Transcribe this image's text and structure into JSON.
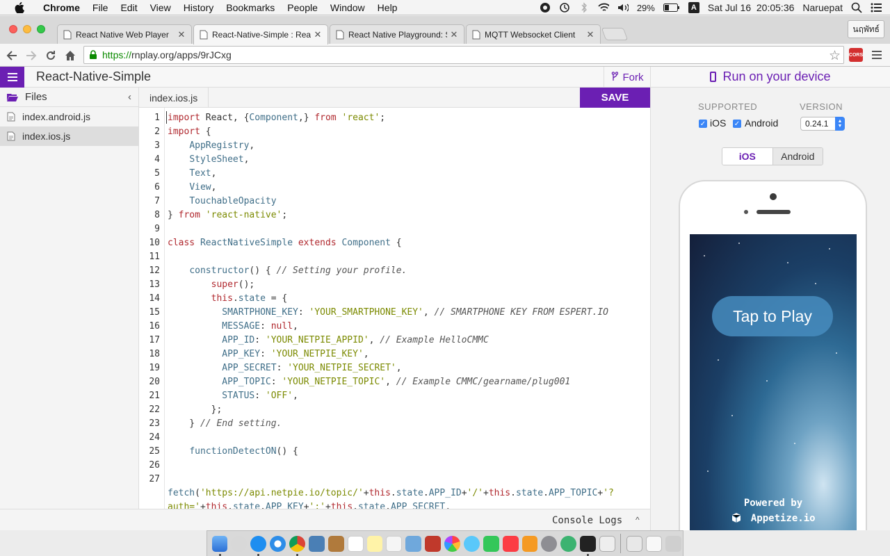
{
  "menubar": {
    "app_name": "Chrome",
    "items": [
      "File",
      "Edit",
      "View",
      "History",
      "Bookmarks",
      "People",
      "Window",
      "Help"
    ],
    "battery": "29%",
    "input_source": "A",
    "datetime": "Sat Jul 16  20:05:36",
    "user": "Naruepat"
  },
  "tabs": [
    {
      "label": "React Native Web Player"
    },
    {
      "label": "React-Native-Simple : Reac"
    },
    {
      "label": "React Native Playground: S"
    },
    {
      "label": "MQTT Websocket Client"
    }
  ],
  "profile_name": "นฤพัทธ์",
  "address_bar": {
    "scheme": "https://",
    "rest": "rnplay.org/apps/9rJCxg"
  },
  "extension_badge": "CORS",
  "app": {
    "title": "React-Native-Simple",
    "fork_label": "Fork",
    "run_label": "Run on your device"
  },
  "sidebar": {
    "header": "Files",
    "files": [
      "index.android.js",
      "index.ios.js"
    ]
  },
  "editor": {
    "tab_label": "index.ios.js",
    "save_label": "SAVE",
    "line_numbers": [
      "1",
      "2",
      "3",
      "4",
      "5",
      "6",
      "7",
      "8",
      "9",
      "10",
      "11",
      "12",
      "13",
      "14",
      "15",
      "16",
      "17",
      "18",
      "19",
      "20",
      "21",
      "22",
      "23",
      "24",
      "25",
      "26",
      "27"
    ],
    "console_label": "Console Logs"
  },
  "device_panel": {
    "supported_label": "SUPPORTED",
    "version_label": "VERSION",
    "ios_label": "iOS",
    "android_label": "Android",
    "version_value": "0.24.1",
    "segment_ios": "iOS",
    "segment_android": "Android",
    "tap_to_play": "Tap to Play",
    "powered_by": "Powered by",
    "appetize": "Appetize.io"
  },
  "colors": {
    "accent_purple": "#6b1fb3",
    "checkbox_blue": "#3b86f7",
    "url_green": "#0b8a00",
    "keyword_red": "#b0282e",
    "string_olive": "#7b8a00",
    "identifier_blue": "#3f6e88"
  },
  "icons": [
    "apple-icon",
    "back-icon",
    "forward-icon",
    "reload-icon",
    "home-icon",
    "lock-icon",
    "star-icon",
    "chrome-menu-icon",
    "hamburger-icon",
    "fork-icon",
    "folder-icon",
    "file-icon",
    "phone-icon"
  ]
}
